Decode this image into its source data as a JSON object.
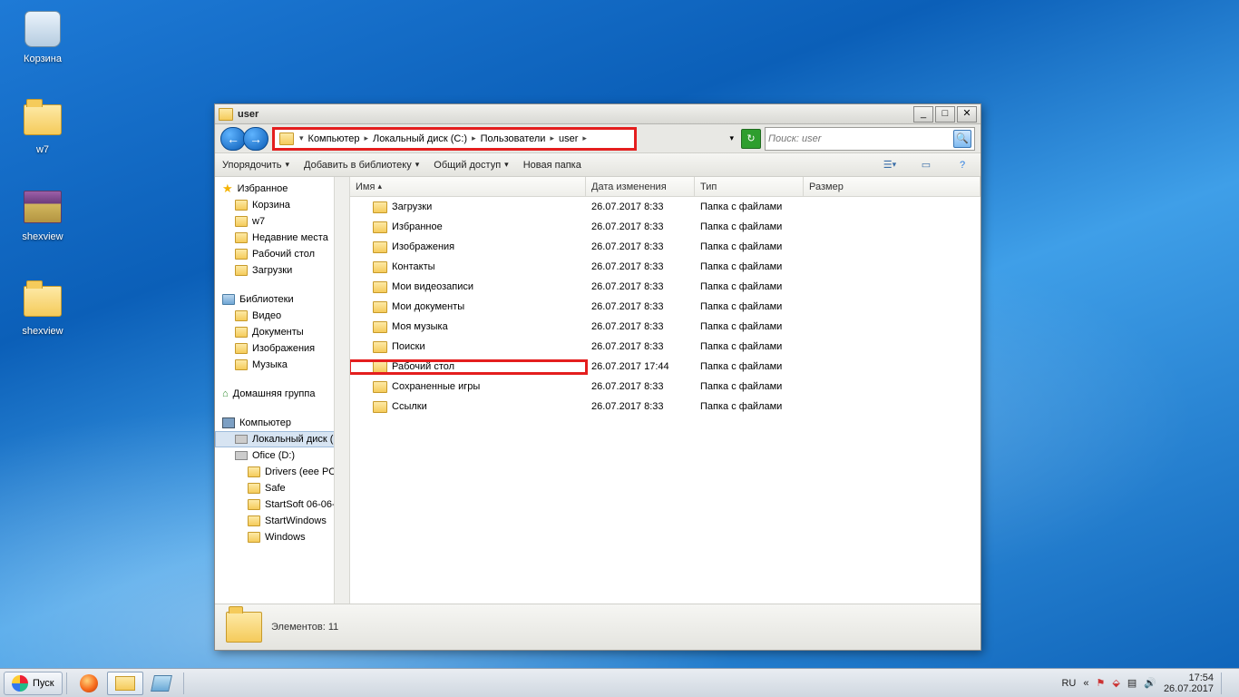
{
  "desktop_icons": [
    {
      "label": "Корзина",
      "type": "bin"
    },
    {
      "label": "w7",
      "type": "folder"
    },
    {
      "label": "shexview",
      "type": "rar"
    },
    {
      "label": "shexview",
      "type": "folder"
    }
  ],
  "window": {
    "title": "user",
    "breadcrumb": [
      "Компьютер",
      "Локальный диск (C:)",
      "Пользователи",
      "user"
    ],
    "search_placeholder": "Поиск: user",
    "toolbar": {
      "organize": "Упорядочить",
      "library": "Добавить в библиотеку",
      "share": "Общий доступ",
      "newfolder": "Новая папка"
    },
    "columns": {
      "name": "Имя",
      "date": "Дата изменения",
      "type": "Тип",
      "size": "Размер"
    },
    "col_widths": {
      "name": 260,
      "date": 120,
      "type": 120,
      "size": 160
    },
    "nav": {
      "favorites": "Избранное",
      "fav_items": [
        "Корзина",
        "w7",
        "Недавние места",
        "Рабочий стол",
        "Загрузки"
      ],
      "libraries": "Библиотеки",
      "lib_items": [
        "Видео",
        "Документы",
        "Изображения",
        "Музыка"
      ],
      "homegroup": "Домашняя группа",
      "computer": "Компьютер",
      "local_disk": "Локальный диск (",
      "ofice": "Ofice (D:)",
      "ofice_children": [
        "Drivers (eee PC",
        "Safe",
        "StartSoft 06-06-",
        "StartWindows",
        "Windows"
      ]
    },
    "rows": [
      {
        "name": "Загрузки",
        "date": "26.07.2017 8:33",
        "type": "Папка с файлами"
      },
      {
        "name": "Избранное",
        "date": "26.07.2017 8:33",
        "type": "Папка с файлами"
      },
      {
        "name": "Изображения",
        "date": "26.07.2017 8:33",
        "type": "Папка с файлами"
      },
      {
        "name": "Контакты",
        "date": "26.07.2017 8:33",
        "type": "Папка с файлами"
      },
      {
        "name": "Мои видеозаписи",
        "date": "26.07.2017 8:33",
        "type": "Папка с файлами"
      },
      {
        "name": "Мои документы",
        "date": "26.07.2017 8:33",
        "type": "Папка с файлами"
      },
      {
        "name": "Моя музыка",
        "date": "26.07.2017 8:33",
        "type": "Папка с файлами"
      },
      {
        "name": "Поиски",
        "date": "26.07.2017 8:33",
        "type": "Папка с файлами"
      },
      {
        "name": "Рабочий стол",
        "date": "26.07.2017 17:44",
        "type": "Папка с файлами",
        "hilite": true
      },
      {
        "name": "Сохраненные игры",
        "date": "26.07.2017 8:33",
        "type": "Папка с файлами"
      },
      {
        "name": "Ссылки",
        "date": "26.07.2017 8:33",
        "type": "Папка с файлами"
      }
    ],
    "status": "Элементов: 11"
  },
  "taskbar": {
    "start": "Пуск",
    "lang": "RU",
    "time": "17:54",
    "date": "26.07.2017"
  }
}
